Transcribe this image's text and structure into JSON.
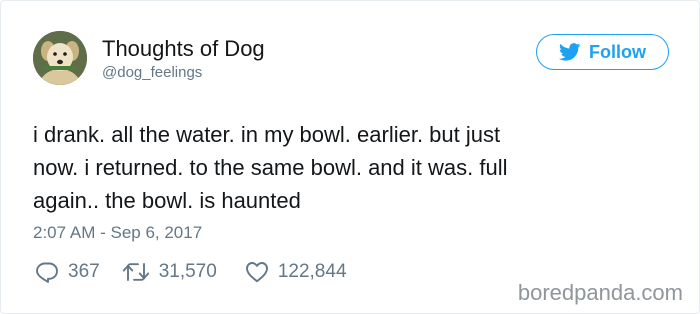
{
  "tweet": {
    "author": {
      "display_name": "Thoughts of Dog",
      "handle": "@dog_feelings",
      "avatar_icon": "dog-avatar"
    },
    "follow_button": {
      "label": "Follow",
      "icon": "twitter-bird-icon",
      "color": "#1da1f2"
    },
    "text_lines": [
      "i drank. all the water. in my bowl. earlier. but just",
      "now. i returned. to the same bowl. and it was. full",
      "again.. the bowl. is haunted"
    ],
    "timestamp": "2:07 AM - Sep 6, 2017",
    "actions": {
      "replies": "367",
      "retweets": "31,570",
      "likes": "122,844"
    }
  },
  "watermark": "boredpanda.com",
  "colors": {
    "text": "#14171a",
    "secondary": "#657786",
    "accent": "#1da1f2",
    "border": "#e6ecf0"
  }
}
